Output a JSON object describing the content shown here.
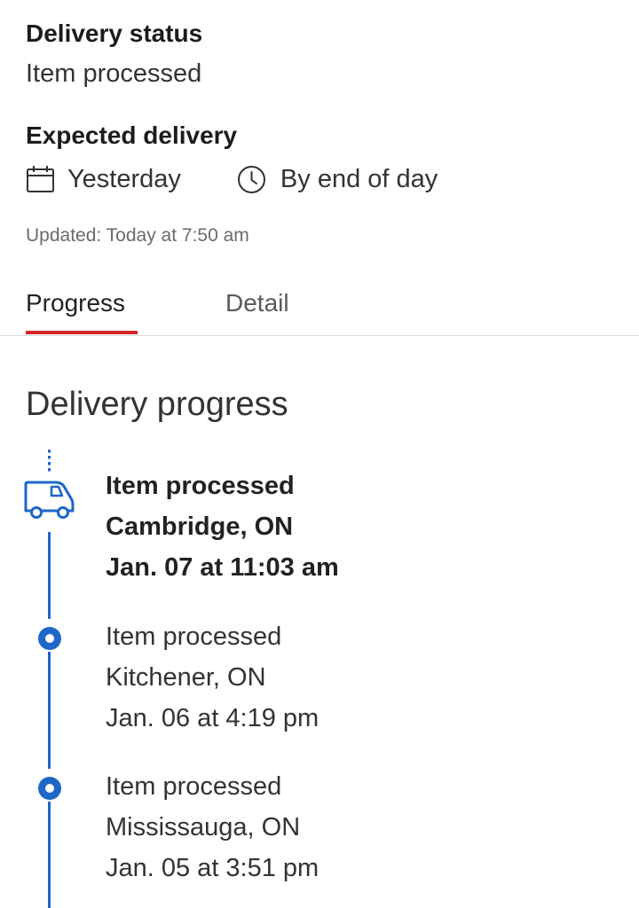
{
  "delivery_status": {
    "title": "Delivery status",
    "value": "Item processed"
  },
  "expected_delivery": {
    "title": "Expected delivery",
    "date": "Yesterday",
    "date_icon": "calendar-icon",
    "time": "By end of day",
    "time_icon": "clock-icon"
  },
  "updated": "Updated: Today at 7:50 am",
  "tabs": [
    {
      "label": "Progress",
      "active": true
    },
    {
      "label": "Detail",
      "active": false
    }
  ],
  "progress": {
    "heading": "Delivery progress",
    "events": [
      {
        "status": "Item processed",
        "location": "Cambridge, ON",
        "datetime": "Jan. 07 at 11:03 am",
        "current": true,
        "icon": "truck-icon"
      },
      {
        "status": "Item processed",
        "location": "Kitchener, ON",
        "datetime": "Jan. 06 at 4:19 pm",
        "current": false,
        "icon": "timeline-dot-icon"
      },
      {
        "status": "Item processed",
        "location": "Mississauga, ON",
        "datetime": "Jan. 05 at 3:51 pm",
        "current": false,
        "icon": "timeline-dot-icon"
      }
    ]
  },
  "colors": {
    "accent_blue": "#1f66c9",
    "tab_underline_red": "#d2262b",
    "text_primary": "#222222",
    "text_secondary": "#6b6b6b"
  }
}
